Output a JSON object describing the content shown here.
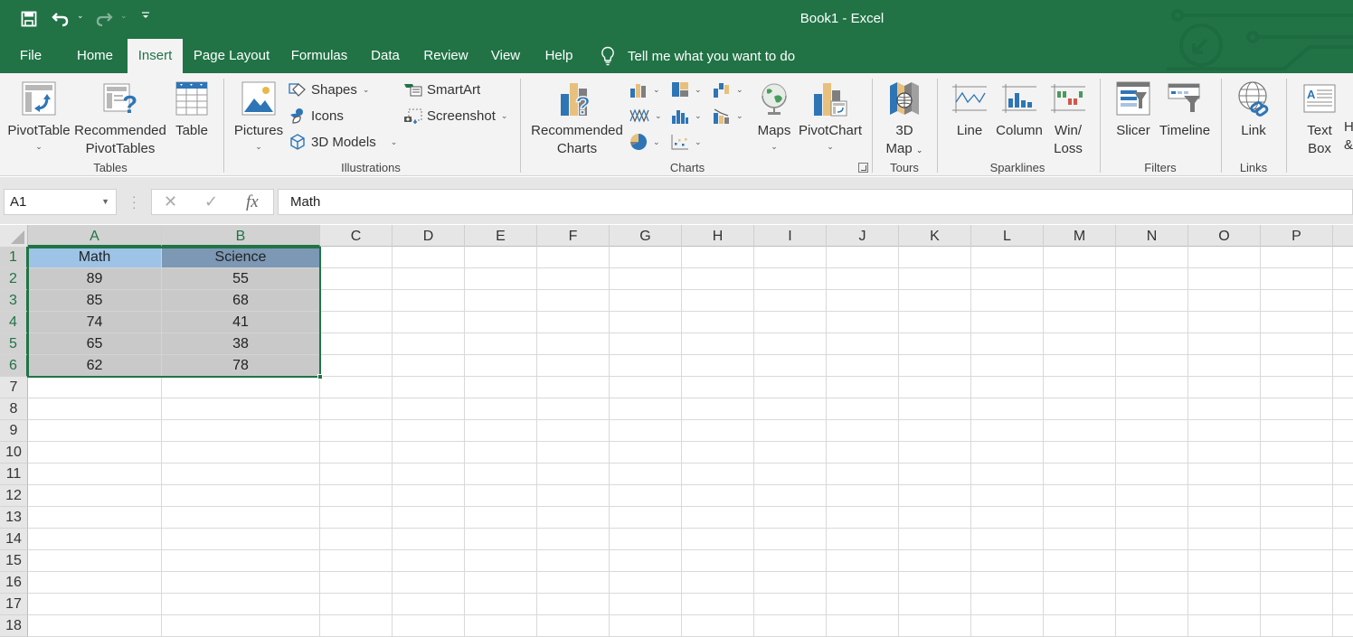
{
  "window": {
    "title": "Book1  -  Excel"
  },
  "quick_access": [
    {
      "name": "save",
      "icon": "save-icon"
    },
    {
      "name": "undo",
      "icon": "undo-icon"
    },
    {
      "name": "redo",
      "icon": "redo-icon"
    },
    {
      "name": "customize",
      "icon": "customize-qat-icon"
    }
  ],
  "tabs": [
    {
      "label": "File"
    },
    {
      "label": "Home"
    },
    {
      "label": "Insert",
      "active": true
    },
    {
      "label": "Page Layout"
    },
    {
      "label": "Formulas"
    },
    {
      "label": "Data"
    },
    {
      "label": "Review"
    },
    {
      "label": "View"
    },
    {
      "label": "Help"
    }
  ],
  "tell_me": {
    "placeholder": "Tell me what you want to do",
    "icon": "lightbulb-icon"
  },
  "ribbon": {
    "groups": {
      "tables": "Tables",
      "illustrations": "Illustrations",
      "charts": "Charts",
      "tours": "Tours",
      "sparklines": "Sparklines",
      "filters": "Filters",
      "links": "Links"
    },
    "buttons": {
      "pivot_table": "PivotTable",
      "recommended_pivot_1": "Recommended",
      "recommended_pivot_2": "PivotTables",
      "table": "Table",
      "pictures": "Pictures",
      "shapes": "Shapes",
      "icons": "Icons",
      "models_3d": "3D Models",
      "smartart": "SmartArt",
      "screenshot": "Screenshot",
      "recommended_charts_1": "Recommended",
      "recommended_charts_2": "Charts",
      "maps": "Maps",
      "pivot_chart": "PivotChart",
      "map_3d_1": "3D",
      "map_3d_2": "Map",
      "line": "Line",
      "column": "Column",
      "win_loss_1": "Win/",
      "win_loss_2": "Loss",
      "slicer": "Slicer",
      "timeline": "Timeline",
      "link": "Link",
      "text_box_1": "Text",
      "text_box_2": "Box",
      "header_footer_1": "H",
      "header_footer_2": "&"
    }
  },
  "formula_bar": {
    "name_box": "A1",
    "cancel_icon": "✕",
    "enter_icon": "✓",
    "fx_icon": "fx",
    "formula": "Math"
  },
  "sheet": {
    "columns": [
      "A",
      "B",
      "C",
      "D",
      "E",
      "F",
      "G",
      "H",
      "I",
      "J",
      "K",
      "L",
      "M",
      "N",
      "O",
      "P"
    ],
    "rows": [
      "1",
      "2",
      "3",
      "4",
      "5",
      "6",
      "7",
      "8",
      "9",
      "10",
      "11",
      "12",
      "13",
      "14",
      "15",
      "16",
      "17",
      "18"
    ],
    "selected_range": "A1:B6",
    "header_colors": {
      "math": "#9dc3e6",
      "science": "#7c98b4",
      "data_fill": "#c9c9c9"
    },
    "table": {
      "headers": [
        "Math",
        "Science"
      ],
      "rows": [
        [
          "89",
          "55"
        ],
        [
          "85",
          "68"
        ],
        [
          "74",
          "41"
        ],
        [
          "65",
          "38"
        ],
        [
          "62",
          "78"
        ]
      ]
    }
  }
}
